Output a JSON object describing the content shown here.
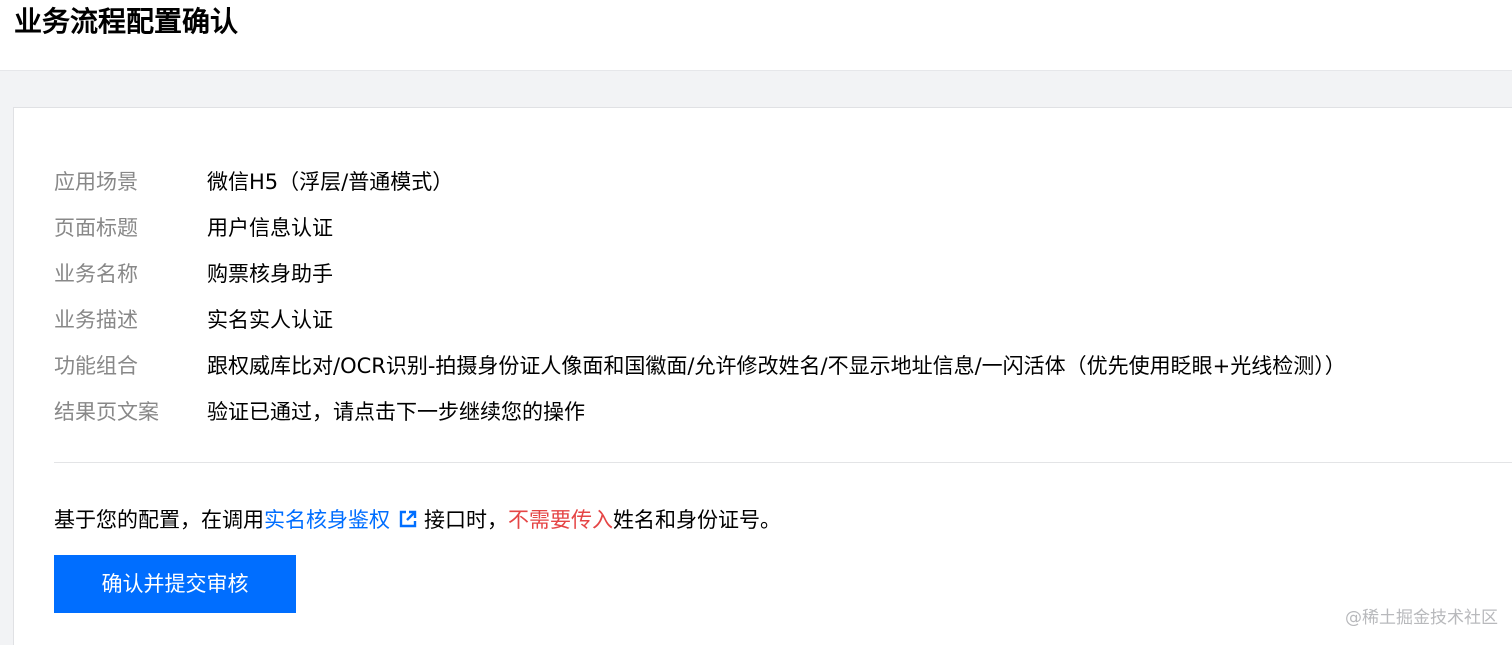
{
  "page": {
    "title": "业务流程配置确认"
  },
  "config": {
    "rows": [
      {
        "label": "应用场景",
        "value": "微信H5（浮层/普通模式）"
      },
      {
        "label": "页面标题",
        "value": "用户信息认证"
      },
      {
        "label": "业务名称",
        "value": "购票核身助手"
      },
      {
        "label": "业务描述",
        "value": "实名实人认证"
      },
      {
        "label": "功能组合",
        "value": "跟权威库比对/OCR识别-拍摄身份证人像面和国徽面/允许修改姓名/不显示地址信息/一闪活体（优先使用眨眼+光线检测））"
      },
      {
        "label": "结果页文案",
        "value": "验证已通过，请点击下一步继续您的操作"
      }
    ]
  },
  "notice": {
    "prefix": "基于您的配置，在调用",
    "link_text": "实名核身鉴权",
    "middle": "接口时，",
    "warning_text": "不需要传入",
    "suffix": "姓名和身份证号。",
    "link_icon": "external-link-icon"
  },
  "actions": {
    "confirm_label": "确认并提交审核"
  },
  "watermark": {
    "text": "@稀土掘金技术社区"
  },
  "colors": {
    "accent": "#006eff",
    "warning": "#e54545",
    "label_gray": "#888888",
    "page_background": "#f2f3f5"
  }
}
